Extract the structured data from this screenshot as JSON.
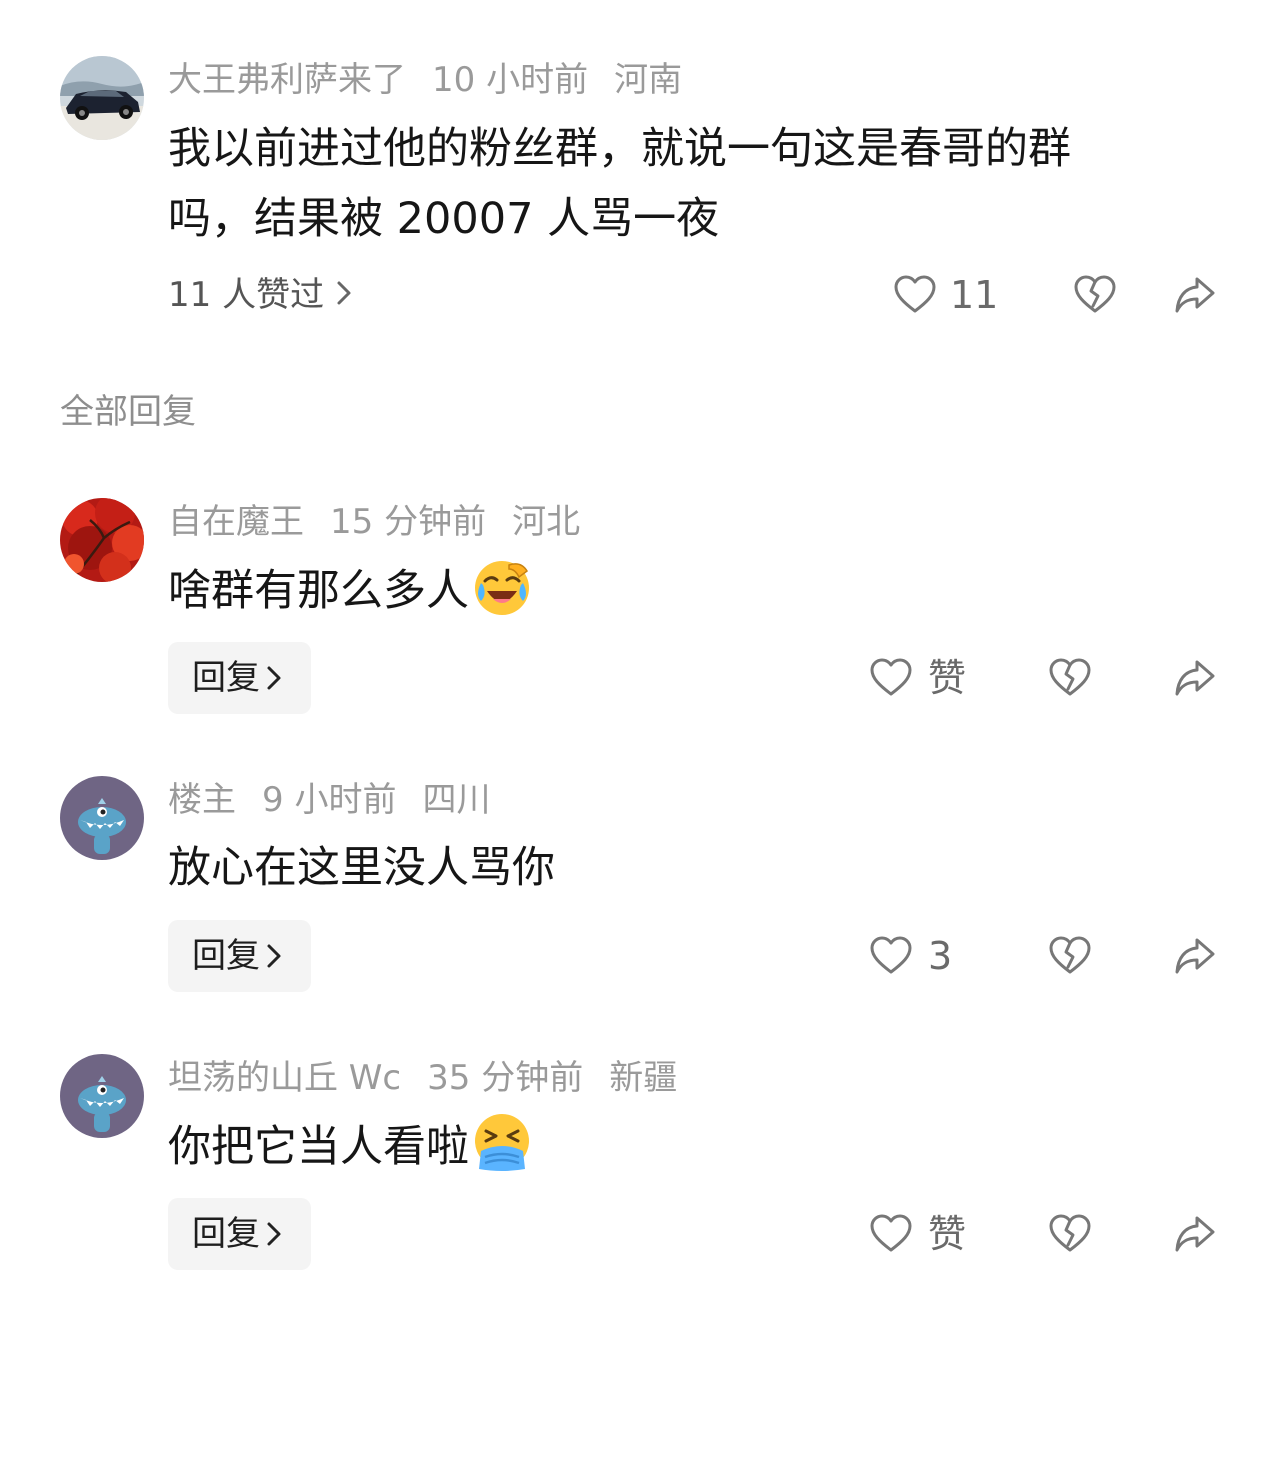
{
  "main_comment": {
    "username": "大王弗利萨来了",
    "time": "10 小时前",
    "location": "河南",
    "text_line1": "我以前进过他的粉丝群，就说一句这是春哥的群",
    "text_line2": "吗，结果被 20007 人骂一夜",
    "likes_summary": "11 人赞过",
    "like_count": "11",
    "avatar_icon": "car-avatar"
  },
  "section_title": "全部回复",
  "replies": [
    {
      "username": "自在魔王",
      "time": "15 分钟前",
      "location": "河北",
      "text": "啥群有那么多人",
      "emoji": "laughing-crying-emoji",
      "reply_label": "回复",
      "like_label": "赞",
      "avatar_icon": "red-maple-avatar"
    },
    {
      "username": "楼主",
      "time": "9 小时前",
      "location": "四川",
      "text": "放心在这里没人骂你",
      "reply_label": "回复",
      "like_label": "3",
      "avatar_icon": "monster-avatar"
    },
    {
      "username": "坦荡的山丘 Wc",
      "time": "35 分钟前",
      "location": "新疆",
      "text": "你把它当人看啦",
      "emoji": "vomiting-emoji",
      "reply_label": "回复",
      "like_label": "赞",
      "avatar_icon": "monster-avatar"
    }
  ],
  "colors": {
    "meta_gray": "#9a9a9a",
    "text_dark": "#161616",
    "reply_button_bg": "#f4f4f4",
    "icon_gray": "#777777",
    "avatar_purple": "#6f6584",
    "monster_blue": "#5aa3c8"
  }
}
